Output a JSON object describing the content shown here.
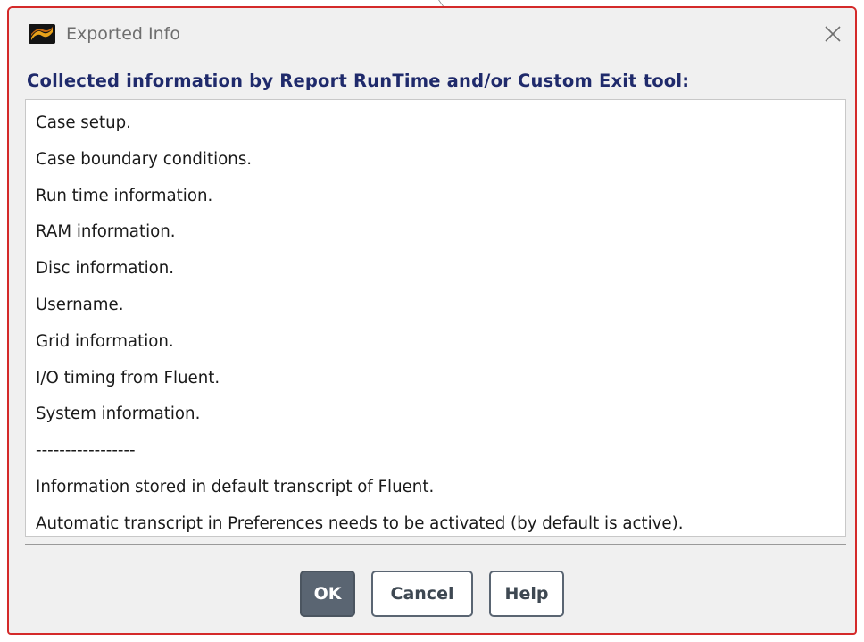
{
  "window": {
    "title": "Exported Info",
    "icon": "fluent-app-icon",
    "close_icon": "close-icon"
  },
  "heading": "Collected information by Report RunTime and/or Custom Exit tool:",
  "info_lines": [
    "Case setup.",
    "Case boundary conditions.",
    "Run time information.",
    "RAM information.",
    "Disc information.",
    "Username.",
    "Grid information.",
    "I/O timing from Fluent.",
    "System information.",
    "-----------------",
    "Information stored in default transcript of Fluent.",
    "Automatic transcript in Preferences needs to be activated (by default is active)."
  ],
  "buttons": {
    "ok": "OK",
    "cancel": "Cancel",
    "help": "Help"
  },
  "colors": {
    "heading": "#1f2a6b",
    "dialog_border": "#d42a2a",
    "ok_button": "#5a6572"
  }
}
